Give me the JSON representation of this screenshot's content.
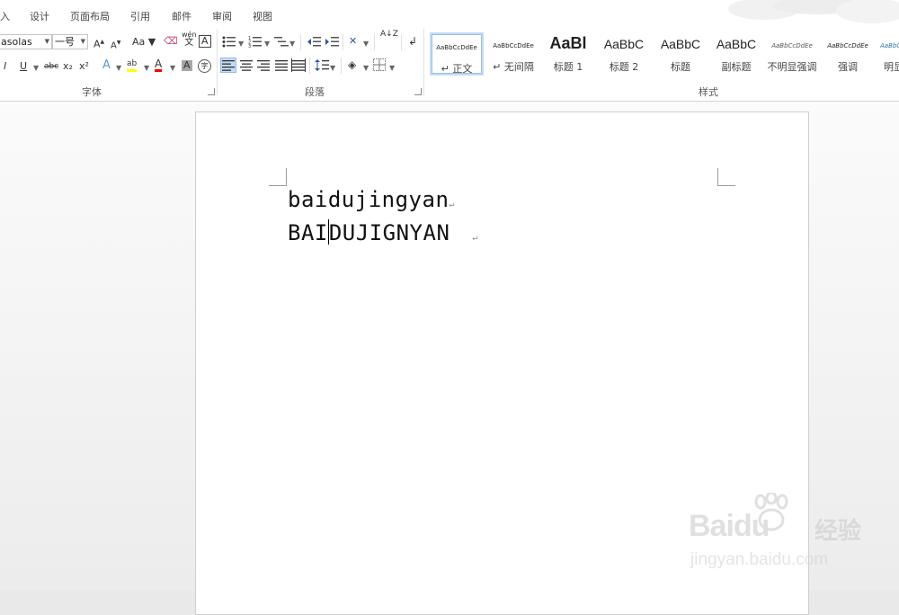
{
  "tabs": [
    "入",
    "设计",
    "页面布局",
    "引用",
    "邮件",
    "审阅",
    "视图"
  ],
  "font": {
    "name": "asolas",
    "size": "一号",
    "group_label": "字体",
    "grow": "A",
    "shrink": "A",
    "case": "Aa",
    "pinyin_top": "wén",
    "pinyin_bottom": "文",
    "border_char": "A",
    "italic": "I",
    "underline": "U",
    "strike": "abc",
    "sub": "x₂",
    "sup": "x²",
    "effects": "A",
    "highlight": "ab",
    "color": "A",
    "shade": "A",
    "enclose": "字"
  },
  "paragraph": {
    "group_label": "段落",
    "sort": "A↓Z"
  },
  "styles": {
    "group_label": "样式",
    "items": [
      {
        "preview": "AaBbCcDdEe",
        "name": "↵ 正文"
      },
      {
        "preview": "AaBbCcDdEe",
        "name": "↵ 无间隔"
      },
      {
        "preview": "AaBl",
        "name": "标题 1"
      },
      {
        "preview": "AaBbC",
        "name": "标题 2"
      },
      {
        "preview": "AaBbC",
        "name": "标题"
      },
      {
        "preview": "AaBbC",
        "name": "副标题"
      },
      {
        "preview": "AaBbCcDdEe",
        "name": "不明显强调"
      },
      {
        "preview": "AaBbCcDdEe",
        "name": "强调"
      },
      {
        "preview": "AaBbCcDdEe",
        "name": "明显"
      }
    ]
  },
  "document": {
    "line1": "baidujingyan",
    "line2_before": "BAI",
    "line2_after": "DUJIGNYAN",
    "para_mark": "↵"
  },
  "watermark": {
    "brand": "Baidu",
    "brand_cn": "经验",
    "url": "jingyan.baidu.com"
  },
  "colors": {
    "accent": "#2b579a",
    "highlight": "#ffff00",
    "font_color": "#ff0000"
  }
}
